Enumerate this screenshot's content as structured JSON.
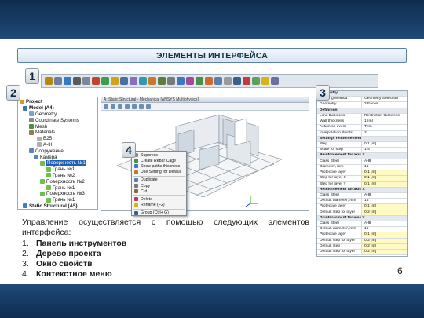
{
  "slide": {
    "title": "ЭЛЕМЕНТЫ ИНТЕРФЕЙСА",
    "page_number": "6",
    "badges": [
      "1",
      "2",
      "3",
      "4"
    ],
    "intro_words": [
      "Управление",
      "осуществляется",
      "с",
      "помощью",
      "следующих",
      "элементов"
    ],
    "intro_tail": "интерфейса:",
    "list": [
      {
        "num": "1.",
        "text": "Панель инструментов"
      },
      {
        "num": "2.",
        "text": "Дерево проекта"
      },
      {
        "num": "3.",
        "text": "Окно свойств"
      },
      {
        "num": "4.",
        "text": "Контекстное меню"
      }
    ]
  },
  "tree": {
    "rows": [
      {
        "label": "Project",
        "bold": true
      },
      {
        "label": "Model (A4)",
        "bold": true
      },
      {
        "label": "Geometry"
      },
      {
        "label": "Coordinate Systems"
      },
      {
        "label": "Mesh"
      },
      {
        "label": "Materials"
      },
      {
        "label": "B25"
      },
      {
        "label": "A-III"
      },
      {
        "label": "Сооружение"
      },
      {
        "label": "Камера"
      },
      {
        "label": "Поверхность №1",
        "selected": true
      },
      {
        "label": "Грань №1"
      },
      {
        "label": "Грань №2"
      },
      {
        "label": "Поверхность №2"
      },
      {
        "label": "Грань №1"
      },
      {
        "label": "Поверхность №3"
      },
      {
        "label": "Грань №1"
      },
      {
        "label": "Static Structural (A5)",
        "bold": true
      }
    ]
  },
  "viewport": {
    "title": "A: Static Structural - Mechanical [ANSYS Multiphysics]"
  },
  "context_menu": {
    "items": [
      {
        "label": "Suppress"
      },
      {
        "label": "Create Rebar Cage"
      },
      {
        "label": "Show paths thickness"
      },
      {
        "label": "Use Setting for Default"
      },
      {
        "sep": true
      },
      {
        "label": "Duplicate"
      },
      {
        "label": "Copy"
      },
      {
        "label": "Cut"
      },
      {
        "sep": true
      },
      {
        "label": "Delete"
      },
      {
        "label": "Rename (F2)"
      },
      {
        "sep": true
      },
      {
        "label": "Group (Ctrl+ G)"
      }
    ]
  },
  "properties": {
    "rows": [
      {
        "group": "Geometry"
      },
      {
        "k": "Scoping Method",
        "v": "Geometry Selection"
      },
      {
        "k": "Geometry",
        "v": "2 Faces"
      },
      {
        "group": "Definition"
      },
      {
        "k": "Limit thickness",
        "v": "Restriction thickness"
      },
      {
        "k": "Wall thickness",
        "v": "1 [m]"
      },
      {
        "k": "Action on event",
        "v": "Trim"
      },
      {
        "k": "Interpolation Points",
        "v": "2"
      },
      {
        "group": "Settings reinforcement"
      },
      {
        "k": "Step",
        "v": "0.1 [m]"
      },
      {
        "k": "Scale for step",
        "v": "1:4"
      },
      {
        "group": "Reinforcement for axis Z"
      },
      {
        "k": "Class Steel",
        "v": "A-Ⅲ"
      },
      {
        "k": "Diameter, mm",
        "v": "16"
      },
      {
        "k": "Protective layer",
        "v": "0.1 [m]",
        "yel": true
      },
      {
        "k": "Step for layer X",
        "v": "0.1 [m]",
        "yel": true
      },
      {
        "k": "Step for layer Y",
        "v": "0.1 [m]",
        "yel": true
      },
      {
        "group": "Reinforcement for axis X"
      },
      {
        "k": "Class Steel",
        "v": "A-Ⅲ"
      },
      {
        "k": "Default diameter, mm",
        "v": "16"
      },
      {
        "k": "Protective layer",
        "v": "0.1 [m]",
        "yel": true
      },
      {
        "k": "Default step for layer",
        "v": "0.2 [m]",
        "yel": true
      },
      {
        "group": "Reinforcement for axis Y"
      },
      {
        "k": "Class Steel",
        "v": "A-Ⅲ"
      },
      {
        "k": "Default diameter, mm",
        "v": "16"
      },
      {
        "k": "Protective layer",
        "v": "0.1 [m]",
        "yel": true
      },
      {
        "k": "Default step for layer",
        "v": "0.2 [m]",
        "yel": true
      },
      {
        "k": "Default step",
        "v": "0.2 [m]",
        "yel": true
      },
      {
        "k": "Default step for layer",
        "v": "0.2 [m]",
        "yel": true
      }
    ]
  },
  "colors": {
    "band": "#1a3d66",
    "accent": "#1f5fb5",
    "highlight": "#fff9c4"
  }
}
